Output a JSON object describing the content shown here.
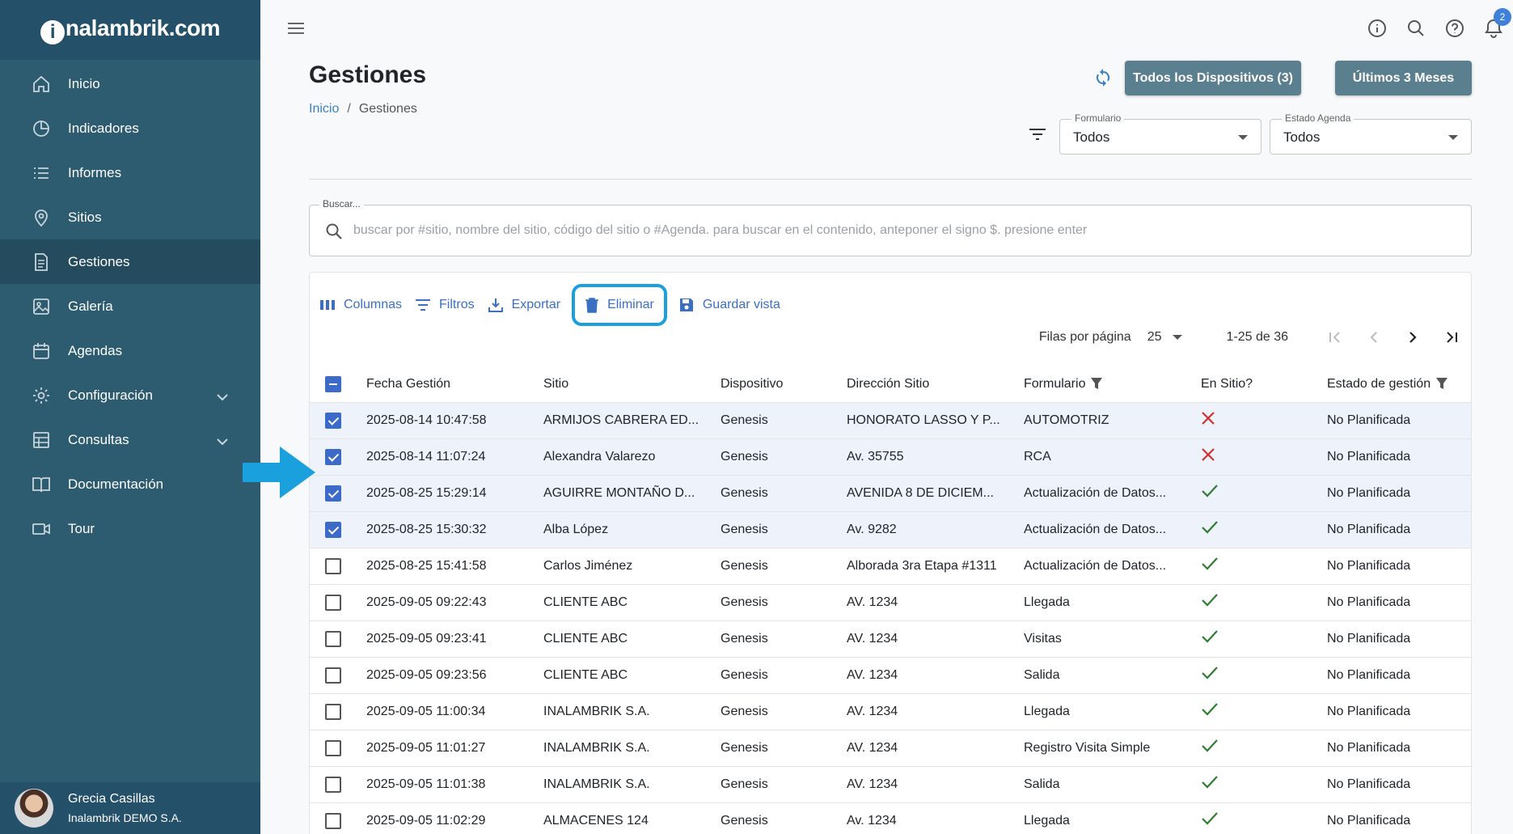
{
  "brand": {
    "logo_i": "i",
    "logo_text": "nalambrik.com"
  },
  "sidebar": {
    "items": [
      {
        "label": "Inicio",
        "icon": "home-icon"
      },
      {
        "label": "Indicadores",
        "icon": "pie-chart-icon"
      },
      {
        "label": "Informes",
        "icon": "list-icon"
      },
      {
        "label": "Sitios",
        "icon": "location-pin-icon"
      },
      {
        "label": "Gestiones",
        "icon": "document-icon",
        "active": true
      },
      {
        "label": "Galería",
        "icon": "image-icon"
      },
      {
        "label": "Agendas",
        "icon": "calendar-icon"
      },
      {
        "label": "Configuración",
        "icon": "gear-icon",
        "expandable": true
      },
      {
        "label": "Consultas",
        "icon": "table-icon",
        "expandable": true
      },
      {
        "label": "Documentación",
        "icon": "book-icon"
      },
      {
        "label": "Tour",
        "icon": "video-icon"
      }
    ],
    "user": {
      "name": "Grecia Casillas",
      "org": "Inalambrik DEMO S.A."
    }
  },
  "topbar": {
    "notification_count": "2"
  },
  "page": {
    "title": "Gestiones",
    "breadcrumb": {
      "home": "Inicio",
      "sep": "/",
      "current": "Gestiones"
    },
    "btn_devices": "Todos los Dispositivos (3)",
    "btn_months": "Últimos 3 Meses",
    "formulario": {
      "label": "Formulario",
      "value": "Todos"
    },
    "estado": {
      "label": "Estado Agenda",
      "value": "Todos"
    }
  },
  "search": {
    "label": "Buscar...",
    "placeholder": "buscar por #sitio, nombre del sitio, código del sitio o #Agenda. para buscar en el contenido, anteponer el signo $. presione enter"
  },
  "toolbar": {
    "columns": "Columnas",
    "filters": "Filtros",
    "export": "Exportar",
    "delete": "Eliminar",
    "save_view": "Guardar vista"
  },
  "pager": {
    "rows_label": "Filas por página",
    "rows_value": "25",
    "range": "1-25 de 36"
  },
  "table": {
    "headers": [
      "Fecha Gestión",
      "Sitio",
      "Dispositivo",
      "Dirección Sitio",
      "Formulario",
      "En Sitio?",
      "Estado de gestión"
    ],
    "rows": [
      {
        "checked": true,
        "fecha": "2025-08-14 10:47:58",
        "sitio": "ARMIJOS CABRERA ED...",
        "dispositivo": "Genesis",
        "direccion": "HONORATO LASSO Y P...",
        "formulario": "AUTOMOTRIZ",
        "en_sitio": false,
        "estado": "No Planificada"
      },
      {
        "checked": true,
        "fecha": "2025-08-14 11:07:24",
        "sitio": "Alexandra Valarezo",
        "dispositivo": "Genesis",
        "direccion": "Av. 35755",
        "formulario": "RCA",
        "en_sitio": false,
        "estado": "No Planificada"
      },
      {
        "checked": true,
        "fecha": "2025-08-25 15:29:14",
        "sitio": "AGUIRRE MONTAÑO D...",
        "dispositivo": "Genesis",
        "direccion": "AVENIDA 8 DE DICIEM...",
        "formulario": "Actualización de Datos...",
        "en_sitio": true,
        "estado": "No Planificada"
      },
      {
        "checked": true,
        "fecha": "2025-08-25 15:30:32",
        "sitio": "Alba López",
        "dispositivo": "Genesis",
        "direccion": "Av. 9282",
        "formulario": "Actualización de Datos...",
        "en_sitio": true,
        "estado": "No Planificada"
      },
      {
        "checked": false,
        "fecha": "2025-08-25 15:41:58",
        "sitio": "Carlos Jiménez",
        "dispositivo": "Genesis",
        "direccion": "Alborada 3ra Etapa #1311",
        "formulario": "Actualización de Datos...",
        "en_sitio": true,
        "estado": "No Planificada"
      },
      {
        "checked": false,
        "fecha": "2025-09-05 09:22:43",
        "sitio": "CLIENTE ABC",
        "dispositivo": "Genesis",
        "direccion": "AV. 1234",
        "formulario": "Llegada",
        "en_sitio": true,
        "estado": "No Planificada"
      },
      {
        "checked": false,
        "fecha": "2025-09-05 09:23:41",
        "sitio": "CLIENTE ABC",
        "dispositivo": "Genesis",
        "direccion": "AV. 1234",
        "formulario": "Visitas",
        "en_sitio": true,
        "estado": "No Planificada"
      },
      {
        "checked": false,
        "fecha": "2025-09-05 09:23:56",
        "sitio": "CLIENTE ABC",
        "dispositivo": "Genesis",
        "direccion": "AV. 1234",
        "formulario": "Salida",
        "en_sitio": true,
        "estado": "No Planificada"
      },
      {
        "checked": false,
        "fecha": "2025-09-05 11:00:34",
        "sitio": "INALAMBRIK S.A.",
        "dispositivo": "Genesis",
        "direccion": "AV. 1234",
        "formulario": "Llegada",
        "en_sitio": true,
        "estado": "No Planificada"
      },
      {
        "checked": false,
        "fecha": "2025-09-05 11:01:27",
        "sitio": "INALAMBRIK S.A.",
        "dispositivo": "Genesis",
        "direccion": "AV. 1234",
        "formulario": "Registro Visita Simple",
        "en_sitio": true,
        "estado": "No Planificada"
      },
      {
        "checked": false,
        "fecha": "2025-09-05 11:01:38",
        "sitio": "INALAMBRIK S.A.",
        "dispositivo": "Genesis",
        "direccion": "AV. 1234",
        "formulario": "Salida",
        "en_sitio": true,
        "estado": "No Planificada"
      },
      {
        "checked": false,
        "fecha": "2025-09-05 11:02:29",
        "sitio": "ALMACENES 124",
        "dispositivo": "Genesis",
        "direccion": "Av. 1234",
        "formulario": "Llegada",
        "en_sitio": true,
        "estado": "No Planificada"
      }
    ]
  },
  "colors": {
    "sidebar": "#2d5b70",
    "accent": "#3b6fc1",
    "highlight": "#1aa0dc",
    "check_green": "#2e7d32",
    "cross_red": "#d32f2f"
  }
}
